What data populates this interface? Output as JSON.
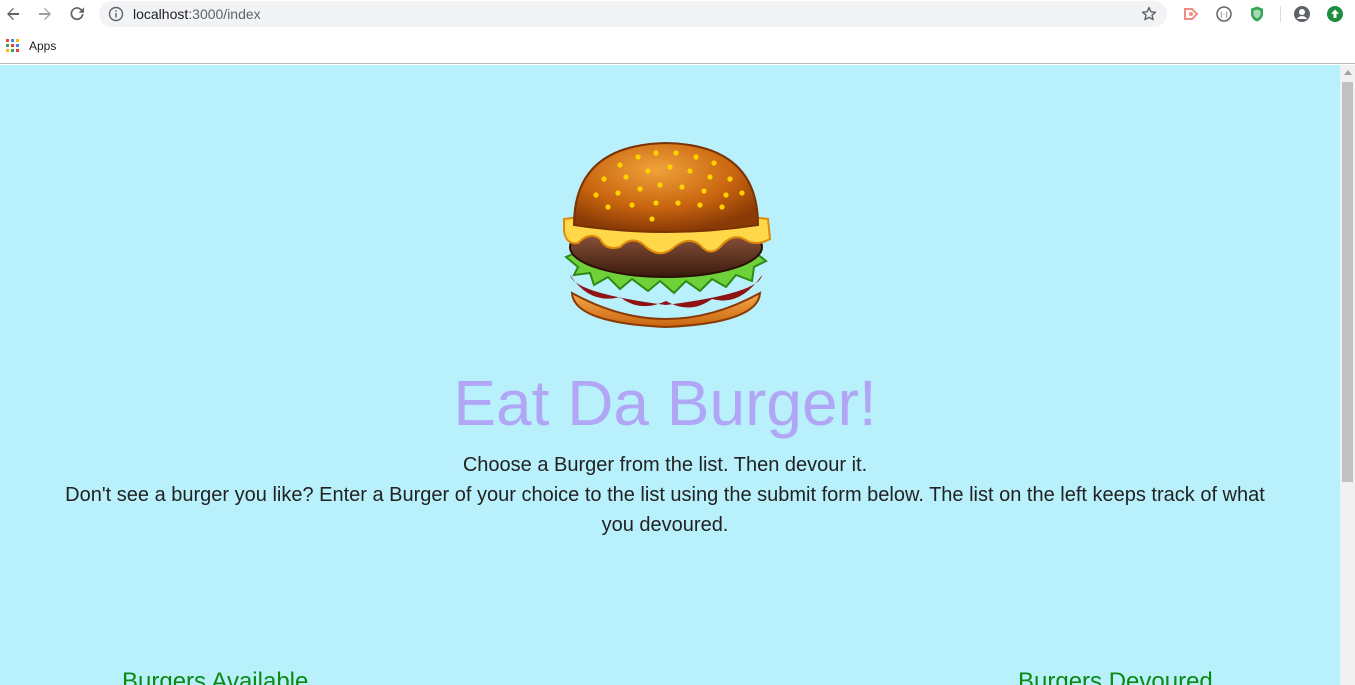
{
  "browser": {
    "url_host": "localhost",
    "url_path": ":3000/index",
    "bookmarks": [
      {
        "label": "Apps",
        "icon": "apps-grid-icon"
      }
    ]
  },
  "page": {
    "title": "Eat Da Burger!",
    "intro_line1": "Choose a Burger from the list. Then devour it.",
    "intro_line2": "Don't see a burger you like? Enter a Burger of your choice to the list using the submit form below. The list on the left keeps track of what you devoured.",
    "available_heading": "Burgers Available",
    "devoured_heading": "Burgers Devoured",
    "hero_icon": "burger-icon"
  },
  "colors": {
    "page_bg": "#b8f0fb",
    "title": "#b0a6f5",
    "heading": "#0a8a12"
  }
}
